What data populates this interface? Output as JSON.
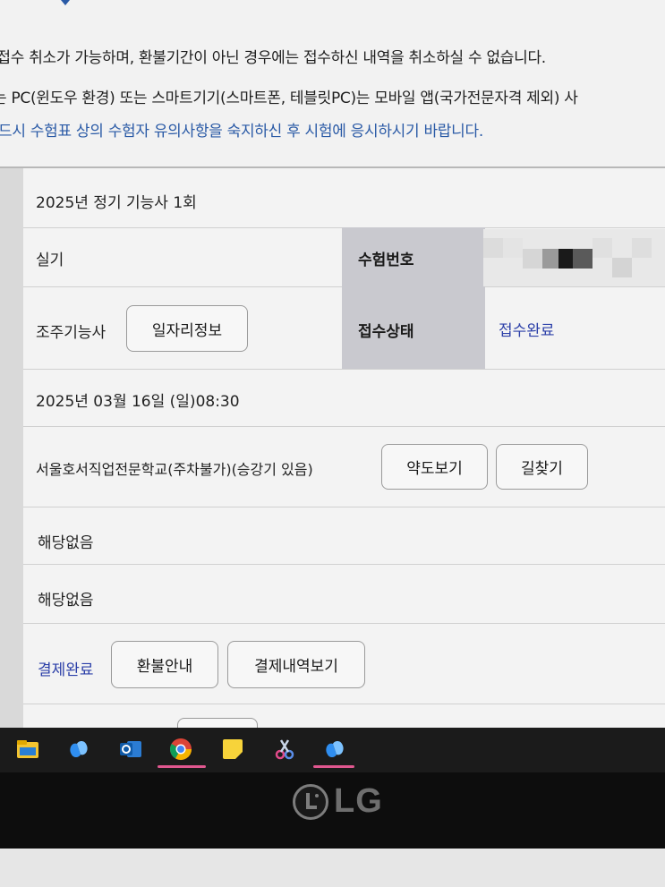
{
  "notice": {
    "line1": "l접수 취소가 가능하며, 환불기간이 아닌 경우에는 접수하신 내역을 취소하실 수 없습니다.",
    "line2": "는 PC(윈도우 환경) 또는 스마트기기(스마트폰, 테블릿PC)는 모바일 앱(국가전문자격 제외) 사",
    "line3": "드시 수험표 상의 수험자 유의사항을 숙지하신 후 시험에 응시하시기 바랍니다."
  },
  "exam": {
    "title": "2025년 정기 기능사 1회",
    "type": "실기",
    "exam_number_label": "수험번호",
    "field": "조주기능사",
    "job_info_button": "일자리정보",
    "status_label": "접수상태",
    "status_value": "접수완료",
    "datetime": "2025년 03월 16일 (일)08:30",
    "venue": "서울호서직업전문학교(주차불가)(승강기 있음)",
    "map_button": "약도보기",
    "directions_button": "길찾기",
    "row6": "해당없음",
    "row7": "해당없음",
    "payment_status": "결제완료",
    "refund_button": "환불안내",
    "payment_history_button": "결제내역보기"
  },
  "taskbar": {
    "icons": [
      "file-explorer-icon",
      "copilot-icon",
      "outlook-icon",
      "chrome-icon",
      "sticky-notes-icon",
      "snipping-tool-icon",
      "copilot-icon"
    ]
  },
  "monitor": {
    "brand": "LG"
  }
}
